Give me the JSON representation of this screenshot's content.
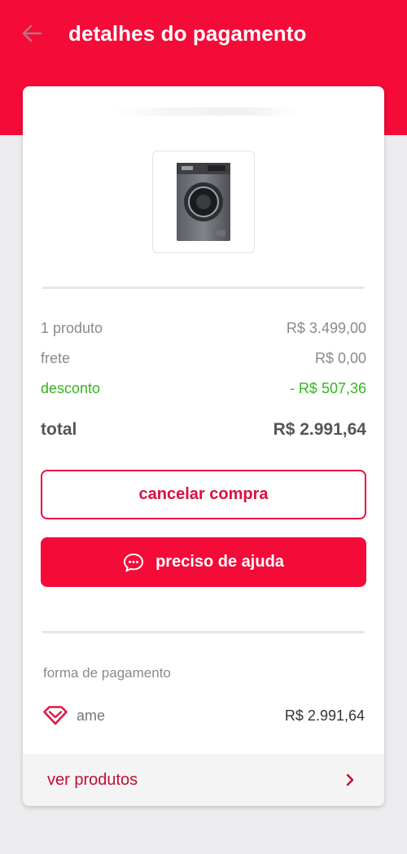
{
  "header": {
    "title": "detalhes do pagamento",
    "back_icon": "arrow-left-icon",
    "bg_color": "#f40b38"
  },
  "product": {
    "image_icon": "washing-machine-icon"
  },
  "summary": {
    "items_label": "1 produto",
    "items_value": "R$ 3.499,00",
    "shipping_label": "frete",
    "shipping_value": "R$ 0,00",
    "discount_label": "desconto",
    "discount_value": "- R$ 507,36",
    "discount_color": "#35b51f",
    "total_label": "total",
    "total_value": "R$ 2.991,64"
  },
  "actions": {
    "cancel_label": "cancelar compra",
    "help_label": "preciso de ajuda",
    "help_icon": "chat-bubble-icon",
    "accent_color": "#f40b38"
  },
  "payment": {
    "section_label": "forma de pagamento",
    "method_icon": "ame-heart-icon",
    "method_name": "ame",
    "amount": "R$ 2.991,64"
  },
  "footer": {
    "link_label": "ver produtos",
    "chevron_icon": "chevron-right-icon"
  }
}
